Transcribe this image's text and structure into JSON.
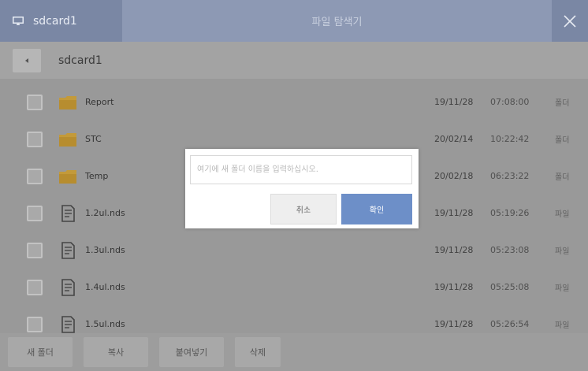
{
  "titlebar": {
    "drive_label": "sdcard1",
    "title": "파일 탐색기",
    "drive_icon": "monitor-icon",
    "close_icon": "close-icon"
  },
  "pathbar": {
    "back_icon": "chevron-left-icon",
    "path": "sdcard1"
  },
  "files": [
    {
      "name": "Report",
      "date": "19/11/28",
      "time": "07:08:00",
      "type": "폴더",
      "icon": "folder-icon"
    },
    {
      "name": "STC",
      "date": "20/02/14",
      "time": "10:22:42",
      "type": "폴더",
      "icon": "folder-icon"
    },
    {
      "name": "Temp",
      "date": "20/02/18",
      "time": "06:23:22",
      "type": "폴더",
      "icon": "folder-icon"
    },
    {
      "name": "1.2ul.nds",
      "date": "19/11/28",
      "time": "05:19:26",
      "type": "파일",
      "icon": "document-icon"
    },
    {
      "name": "1.3ul.nds",
      "date": "19/11/28",
      "time": "05:23:08",
      "type": "파일",
      "icon": "document-icon"
    },
    {
      "name": "1.4ul.nds",
      "date": "19/11/28",
      "time": "05:25:08",
      "type": "파일",
      "icon": "document-icon"
    },
    {
      "name": "1.5ul.nds",
      "date": "19/11/28",
      "time": "05:26:54",
      "type": "파일",
      "icon": "document-icon"
    }
  ],
  "toolbar": {
    "new_folder": "새 폴더",
    "copy": "복사",
    "paste": "붙여넣기",
    "delete": "삭제"
  },
  "dialog": {
    "placeholder": "여기에 새 폴더 이름을 입력하십시오.",
    "value": "",
    "cancel": "취소",
    "ok": "확인"
  },
  "colors": {
    "titlebar": "#8d99b4",
    "accent_button": "#6d8fc8",
    "folder": "#c39a3a"
  }
}
